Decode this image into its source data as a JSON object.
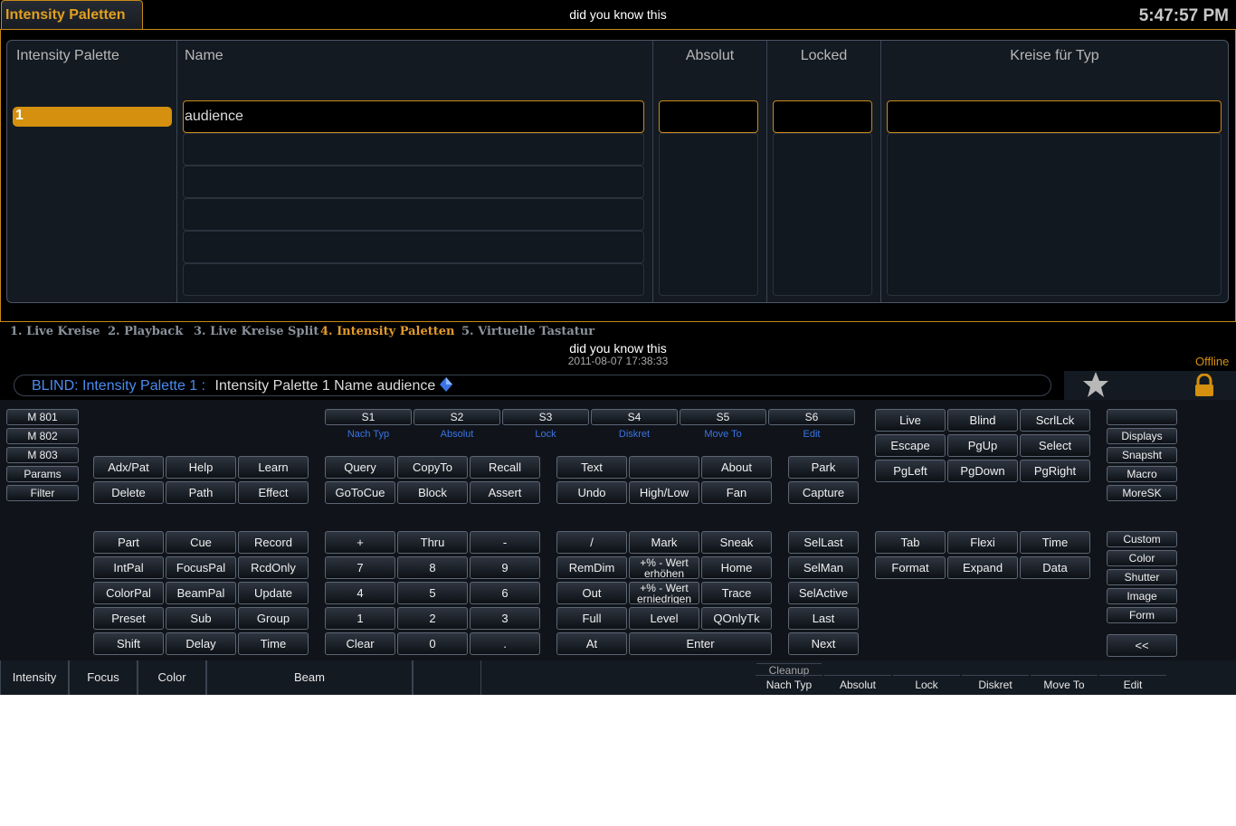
{
  "header": {
    "tab_title": "Intensity Paletten",
    "hint": "did you know this",
    "clock": "5:47:57 PM"
  },
  "table": {
    "columns": [
      "Intensity Palette",
      "Name",
      "Absolut",
      "Locked",
      "Kreise für Typ"
    ],
    "row": {
      "palette": "1",
      "name": "audience"
    }
  },
  "workspace_tabs": [
    "1. Live Kreise",
    "2. Playback",
    "3. Live Kreise Split",
    "4. Intensity Paletten",
    "5. Virtuelle Tastatur"
  ],
  "status": {
    "hint": "did you know this",
    "datetime": "2011-08-07 17:38:33",
    "offline": "Offline"
  },
  "command_line": {
    "mode": "BLIND: Intensity Palette  1 :",
    "text": "Intensity Palette 1 Name audience"
  },
  "icons": {
    "star": "star-icon",
    "lock": "lock-icon",
    "diamond": "diamond-icon"
  },
  "colors": {
    "accent": "#d4900e",
    "blue": "#3a74e4"
  },
  "macro_buttons": [
    "M 801",
    "M 802",
    "M 803",
    "Params",
    "Filter"
  ],
  "softkeys": [
    "S1",
    "S2",
    "S3",
    "S4",
    "S5",
    "S6"
  ],
  "softkey_labels": [
    "Nach Typ",
    "Absolut",
    "Lock",
    "Diskret",
    "Move To",
    "Edit"
  ],
  "keys": {
    "adx": "Adx/Pat",
    "help": "Help",
    "learn": "Learn",
    "delete": "Delete",
    "path": "Path",
    "effect": "Effect",
    "query": "Query",
    "copyto": "CopyTo",
    "recall": "Recall",
    "gotocue": "GoToCue",
    "block": "Block",
    "assert": "Assert",
    "text": "Text",
    "blank": "",
    "about": "About",
    "undo": "Undo",
    "highlow": "High/Low",
    "fan": "Fan",
    "park": "Park",
    "capture": "Capture",
    "live": "Live",
    "blind": "Blind",
    "scrllck": "ScrlLck",
    "escape": "Escape",
    "pgup": "PgUp",
    "select": "Select",
    "pgleft": "PgLeft",
    "pgdown": "PgDown",
    "pgright": "PgRight",
    "part": "Part",
    "cue": "Cue",
    "record": "Record",
    "intpal": "IntPal",
    "focuspal": "FocusPal",
    "rcdonly": "RcdOnly",
    "colorpal": "ColorPal",
    "beampal": "BeamPal",
    "update": "Update",
    "preset": "Preset",
    "sub": "Sub",
    "group": "Group",
    "shift": "Shift",
    "delay": "Delay",
    "time": "Time",
    "plus": "+",
    "thru": "Thru",
    "minus": "-",
    "n7": "7",
    "n8": "8",
    "n9": "9",
    "n4": "4",
    "n5": "5",
    "n6": "6",
    "n1": "1",
    "n2": "2",
    "n3": "3",
    "clear": "Clear",
    "n0": "0",
    "dot": ".",
    "slash": "/",
    "mark": "Mark",
    "sneak": "Sneak",
    "remdim": "RemDim",
    "plus_pct": "+%  -  Wert erhöhen",
    "home": "Home",
    "out": "Out",
    "minus_pct": "+%  -  Wert erniedrigen",
    "trace": "Trace",
    "full": "Full",
    "level": "Level",
    "qonlytk": "QOnlyTk",
    "at": "At",
    "enter": "Enter",
    "sellast": "SelLast",
    "selman": "SelMan",
    "selactive": "SelActive",
    "last": "Last",
    "next": "Next",
    "tab": "Tab",
    "flexi": "Flexi",
    "time2": "Time",
    "format": "Format",
    "expand": "Expand",
    "data": "Data"
  },
  "side_buttons": [
    "",
    "Displays",
    "Snapsht",
    "Macro",
    "MoreSK"
  ],
  "side_buttons2": [
    "Custom",
    "Color",
    "Shutter",
    "Image",
    "Form"
  ],
  "back_button": "<<",
  "categories": [
    "Intensity",
    "Focus",
    "Color",
    "Beam",
    ""
  ],
  "bottom_softkeys": {
    "cleanup": "Cleanup",
    "labels": [
      "Nach Typ",
      "Absolut",
      "Lock",
      "Diskret",
      "Move To",
      "Edit"
    ]
  }
}
